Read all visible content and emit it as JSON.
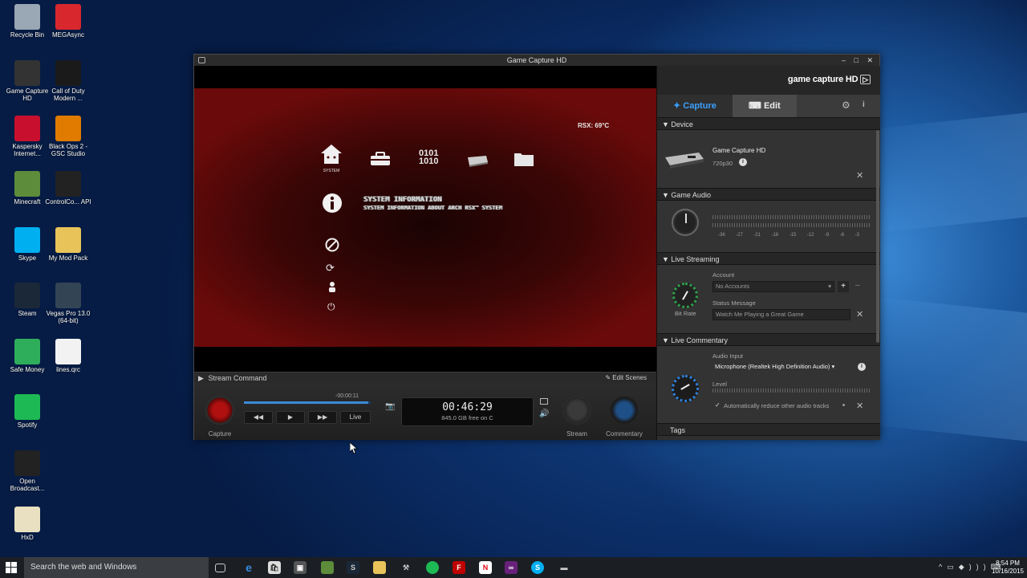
{
  "desktop": {
    "icons": [
      {
        "label": "Recycle Bin",
        "icon": "recycle-bin-icon",
        "color": "#9aa7b4"
      },
      {
        "label": "MEGAsync",
        "icon": "mega-icon",
        "color": "#d9272e"
      },
      {
        "label": "Game Capture HD",
        "icon": "game-capture-icon",
        "color": "#333333"
      },
      {
        "label": "Call of Duty Modern ...",
        "icon": "call-of-duty-icon",
        "color": "#1a1a1a"
      },
      {
        "label": "Kaspersky Internet...",
        "icon": "kaspersky-icon",
        "color": "#c8102e"
      },
      {
        "label": "Black Ops 2 - GSC Studio",
        "icon": "black-ops-icon",
        "color": "#e07b00"
      },
      {
        "label": "Minecraft",
        "icon": "minecraft-icon",
        "color": "#5d8c3a"
      },
      {
        "label": "ControlCo... API",
        "icon": "controller-icon",
        "color": "#222222"
      },
      {
        "label": "Skype",
        "icon": "skype-icon",
        "color": "#00aff0"
      },
      {
        "label": "My Mod Pack",
        "icon": "folder-icon",
        "color": "#e8c35a"
      },
      {
        "label": "Steam",
        "icon": "steam-icon",
        "color": "#1b2838"
      },
      {
        "label": "Vegas Pro 13.0 (64-bit)",
        "icon": "vegas-icon",
        "color": "#334455"
      },
      {
        "label": "Safe Money",
        "icon": "safe-money-icon",
        "color": "#2eae5b"
      },
      {
        "label": "lines.qrc",
        "icon": "file-icon",
        "color": "#f2f2f2"
      },
      {
        "label": "Spotify",
        "icon": "spotify-icon",
        "color": "#1db954"
      },
      {
        "label": "Open Broadcast...",
        "icon": "obs-icon",
        "color": "#222222"
      },
      {
        "label": "HxD",
        "icon": "hxd-icon",
        "color": "#e8e0c0"
      }
    ]
  },
  "window": {
    "title": "Game Capture HD",
    "controls": "– □ ✕"
  },
  "preview": {
    "temp": "RSX: 69°C",
    "icons": {
      "binary": "0101\n1010"
    },
    "home_label": "SYSTEM",
    "info_title": "SYSTEM INFORMATION",
    "info_sub": "SYSTEM INFORMATION ABOUT ARCH RSX™ SYSTEM"
  },
  "stream_bar": {
    "label": "Stream Command",
    "edit": "Edit Scenes"
  },
  "controls": {
    "capture": "Capture",
    "stream": "Stream",
    "commentary": "Commentary",
    "live": "Live",
    "elapsed": "-00:00:11",
    "time": "00:46:29",
    "free": "845.0 GB free on C",
    "progress": 0.98
  },
  "panel": {
    "logo": "game capture HD",
    "tab_capture": "Capture",
    "tab_edit": "Edit",
    "device": {
      "header": "Device",
      "name": "Game Capture HD",
      "res": "720p30"
    },
    "game_audio": {
      "header": "Game Audio",
      "ticks": [
        "-36",
        "-27",
        "-21",
        "-18",
        "-15",
        "-12",
        "-9",
        "-6",
        "-3"
      ]
    },
    "live_streaming": {
      "header": "Live Streaming",
      "account_label": "Account",
      "account_value": "No Accounts",
      "bitrate": "Bit Rate",
      "status_label": "Status Message",
      "status_value": "Watch Me Playing a Great Game"
    },
    "live_commentary": {
      "header": "Live Commentary",
      "input_label": "Audio Input",
      "input_value": "Microphone (Realtek High Definition Audio)",
      "level": "Level",
      "auto_reduce": "Automatically reduce other audio tracks"
    },
    "tags": {
      "header": "Tags"
    }
  },
  "taskbar": {
    "search": "Search the web and Windows",
    "time": "8:54 PM",
    "date": "10/16/2015"
  }
}
